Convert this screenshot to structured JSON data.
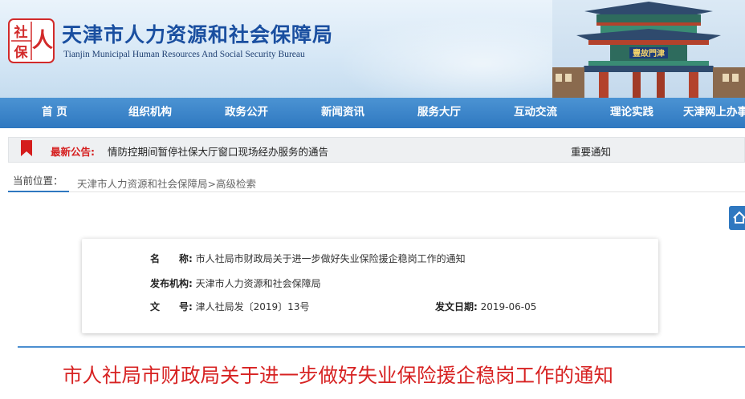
{
  "header": {
    "logo_chars": [
      "人",
      "社",
      "保"
    ],
    "title_cn": "天津市人力资源和社会保障局",
    "title_en": "Tianjin Municipal Human Resources And Social Security Bureau",
    "gate_plaque": "豐故門津",
    "brand_color": "#1a4fa0"
  },
  "nav": {
    "items": [
      "首 页",
      "组织机构",
      "政务公开",
      "新闻资讯",
      "服务大厅",
      "互动交流",
      "理论实践",
      "天津网上办事"
    ],
    "color": "#2f78c0"
  },
  "notice": {
    "label": "最新公告:",
    "text": "情防控期间暂停社保大厅窗口现场经办服务的通告",
    "right": "重要通知",
    "flag_color": "#d51d1d"
  },
  "breadcrumb": {
    "label": "当前位置：",
    "path": [
      "天津市人力资源和社会保障局",
      ">高级检索"
    ]
  },
  "home_icon": "home-icon",
  "info": {
    "name_key": "名　　称:",
    "name_val": "市人社局市财政局关于进一步做好失业保险援企稳岗工作的通知",
    "org_key": "发布机构:",
    "org_val": "天津市人力资源和社会保障局",
    "num_key": "文　　号:",
    "num_val": "津人社局发〔2019〕13号",
    "date_key": "发文日期:",
    "date_val": "2019-06-05"
  },
  "doc_title": "市人社局市财政局关于进一步做好失业保险援企稳岗工作的通知",
  "title_color": "#d72222"
}
